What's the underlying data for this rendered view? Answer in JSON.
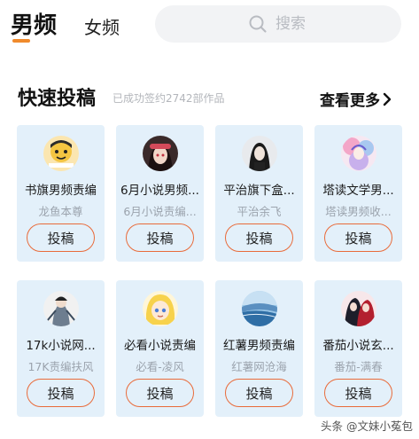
{
  "tabs": {
    "male_label": "男频",
    "female_label": "女频"
  },
  "search": {
    "placeholder": "搜索"
  },
  "section": {
    "title": "快速投稿",
    "subtitle": "已成功签约2742部作品",
    "see_more_label": "查看更多"
  },
  "cards": [
    {
      "name": "书旗男频责编",
      "sub": "龙鱼本尊",
      "button": "投稿"
    },
    {
      "name": "6月小说男频...",
      "sub": "6月小说责编...",
      "button": "投稿"
    },
    {
      "name": "平治旗下盒...",
      "sub": "平治余飞",
      "button": "投稿"
    },
    {
      "name": "塔读文学男...",
      "sub": "塔读男频收...",
      "button": "投稿"
    },
    {
      "name": "17k小说网...",
      "sub": "17K责编扶风",
      "button": "投稿"
    },
    {
      "name": "必看小说责编",
      "sub": "必看-凌风",
      "button": "投稿"
    },
    {
      "name": "红薯男频责编",
      "sub": "红薯网沧海",
      "button": "投稿"
    },
    {
      "name": "番茄小说玄...",
      "sub": "番茄-满春",
      "button": "投稿"
    }
  ],
  "watermark": "头条 @文妹小菟包",
  "colors": {
    "accent": "#f08a2c",
    "button_border": "#e96b3a",
    "card_bg": "#e3f0fa",
    "search_bg": "#f2f3f5"
  }
}
